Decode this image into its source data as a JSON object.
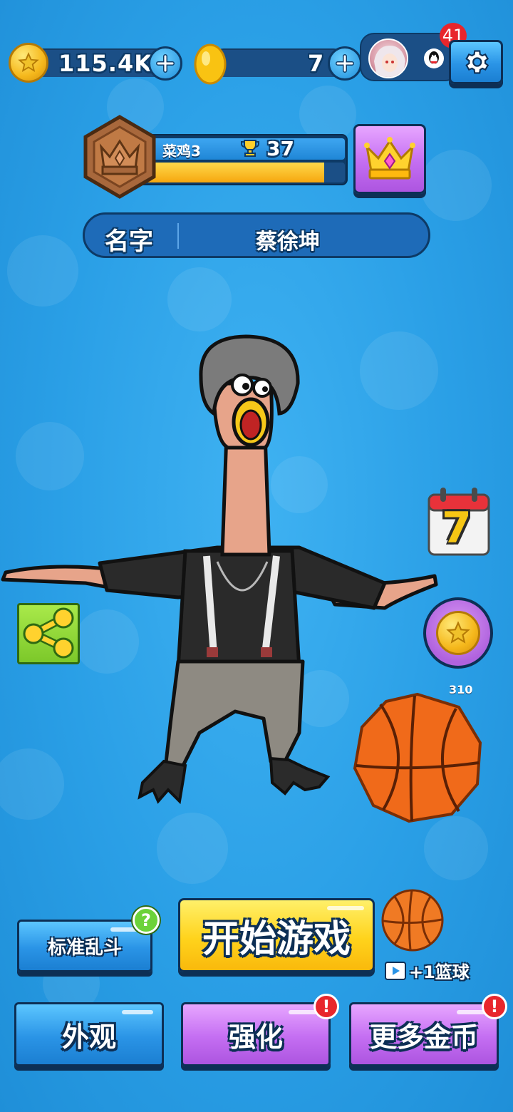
{
  "currency": {
    "coins": "115.4K",
    "gems": "7"
  },
  "profile": {
    "notification_count": "41"
  },
  "rank": {
    "title": "菜鸡3",
    "trophies": "37",
    "progress": 0.9
  },
  "name_bar": {
    "label": "名字",
    "value": "蔡徐坤"
  },
  "side": {
    "calendar_day": "7",
    "basketball_count": "310"
  },
  "buttons": {
    "mode": "标准乱斗",
    "start": "开始游戏",
    "ball_reward": "+1篮球",
    "appearance": "外观",
    "upgrade": "强化",
    "more_coins": "更多金币"
  },
  "colors": {
    "background": "#2a9fe6",
    "accent_yellow": "#ffd31c",
    "accent_purple": "#c46ef2",
    "outline": "#0d2f55"
  },
  "icons": [
    "coin-icon",
    "gem-icon",
    "plus-icon",
    "avatar",
    "qq-icon",
    "gear-icon",
    "rank-badge-icon",
    "trophy-icon",
    "crown-icon",
    "calendar-icon",
    "coin-reward-icon",
    "basketball-icon",
    "share-icon",
    "help-icon",
    "alert-icon",
    "video-icon"
  ]
}
